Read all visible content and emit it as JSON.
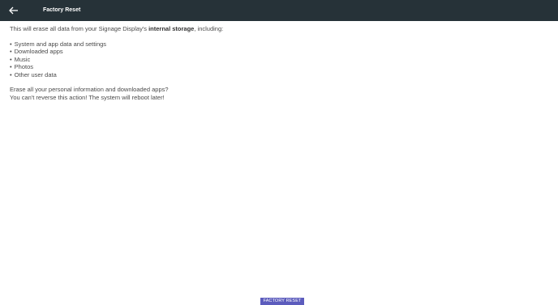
{
  "app_bar": {
    "title": "Factory Reset",
    "back_icon": "arrow-back-icon",
    "background_color": "#263238"
  },
  "content": {
    "intro_before": "This will erase all data from your Signage Display's ",
    "intro_bold": "internal storage",
    "intro_after": ", including:",
    "items": [
      "System and app data and settings",
      "Downloaded apps",
      "Music",
      "Photos",
      "Other user data"
    ],
    "warning_line1": "Erase all your personal information and downloaded apps?",
    "warning_line2": "You can't reverse this action! The system will reboot later!"
  },
  "actions": {
    "factory_reset_label": "FACTORY RESET",
    "button_color": "#5c5cbd"
  }
}
